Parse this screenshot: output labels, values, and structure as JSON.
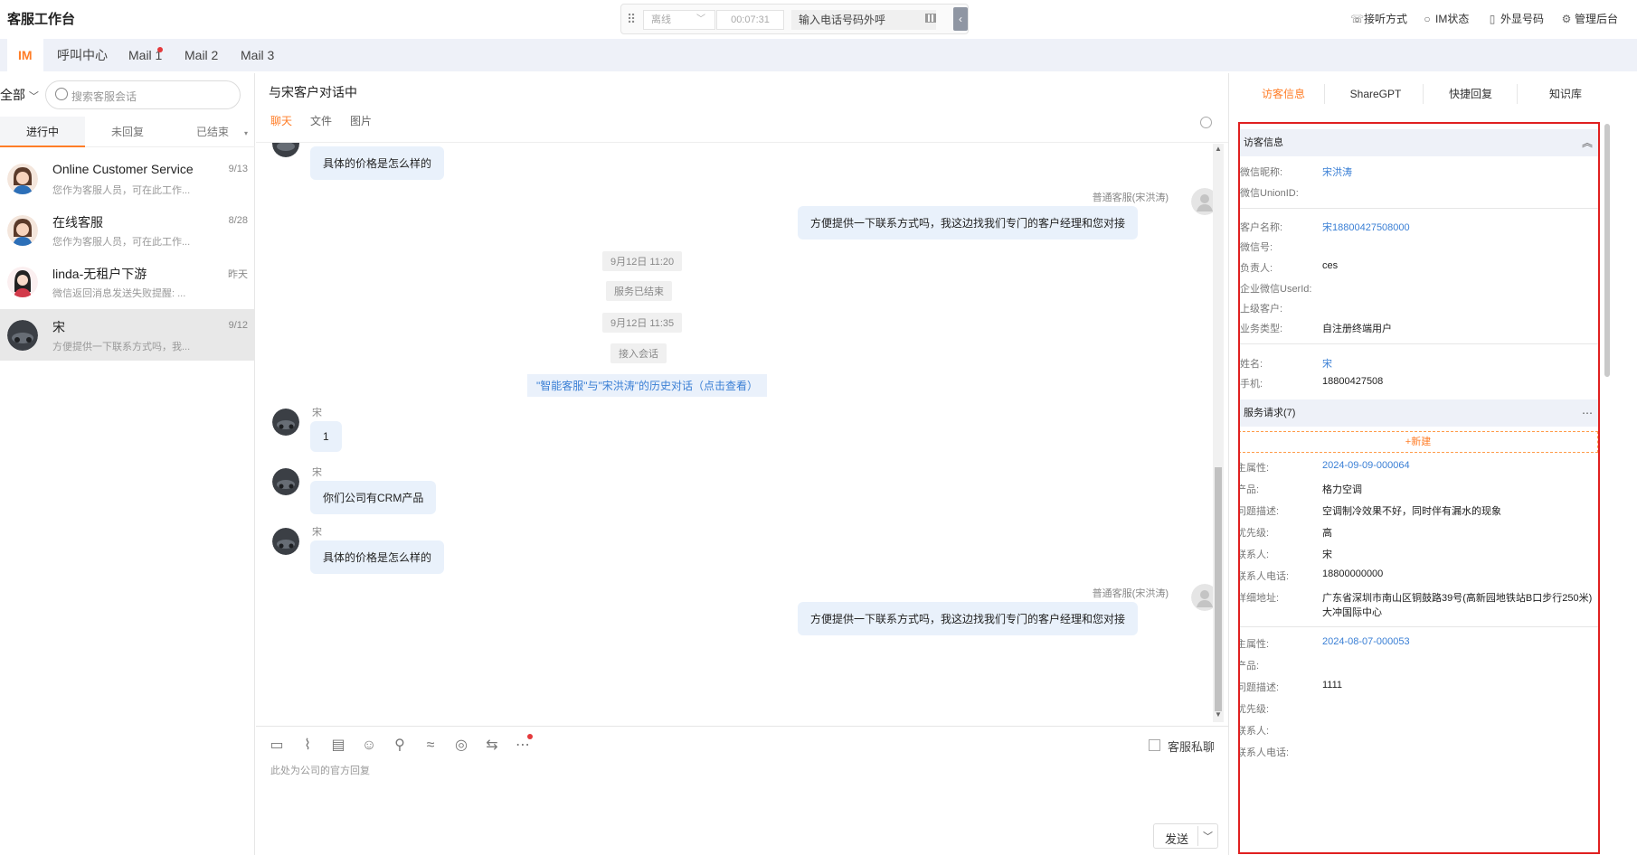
{
  "app": {
    "title": "客服工作台"
  },
  "phone": {
    "status": "离线",
    "timer": "00:07:31",
    "dial_placeholder": "输入电话号码外呼"
  },
  "top_menu": {
    "answer_mode": "接听方式",
    "im_status": "IM状态",
    "outbound_number": "外显号码",
    "admin": "管理后台"
  },
  "tabs": [
    {
      "label": "IM"
    },
    {
      "label": "呼叫中心"
    },
    {
      "label": "Mail 1"
    },
    {
      "label": "Mail 2"
    },
    {
      "label": "Mail 3"
    }
  ],
  "sidebar": {
    "filter": "全部",
    "search_placeholder": "搜索客服会话",
    "subtabs": [
      "进行中",
      "未回复",
      "已结束"
    ],
    "conversations": [
      {
        "name": "Online Customer Service",
        "date": "9/13",
        "preview": "您作为客服人员，可在此工作..."
      },
      {
        "name": "在线客服",
        "date": "8/28",
        "preview": "您作为客服人员，可在此工作..."
      },
      {
        "name": "linda-无租户下游",
        "date": "昨天",
        "preview": "微信返回消息发送失败提醒: ..."
      },
      {
        "name": "宋",
        "date": "9/12",
        "preview": "方便提供一下联系方式吗，我..."
      }
    ]
  },
  "chat": {
    "title": "与宋客户对话中",
    "tabs": [
      "聊天",
      "文件",
      "图片"
    ],
    "messages": {
      "top_bubble": "具体的价格是怎么样的",
      "agent_name_1": "普通客服(宋洪涛)",
      "agent_msg_1": "方便提供一下联系方式吗，我这边找我们专门的客户经理和您对接",
      "time_1": "9月12日 11:20",
      "sys_1": "服务已结束",
      "time_2": "9月12日 11:35",
      "sys_2": "接入会话",
      "history": "\"智能客服\"与\"宋洪涛\"的历史对话（点击查看）",
      "cust_name": "宋",
      "cust_msg_1": "1",
      "cust_msg_2": "你们公司有CRM产品",
      "cust_msg_3": "具体的价格是怎么样的",
      "agent_name_2": "普通客服(宋洪涛)",
      "agent_msg_2": "方便提供一下联系方式吗，我这边找我们专门的客户经理和您对接"
    },
    "private_label": "客服私聊",
    "composer_placeholder": "此处为公司的官方回复",
    "send": "发送"
  },
  "right": {
    "tabs": [
      "访客信息",
      "ShareGPT",
      "快捷回复",
      "知识库"
    ],
    "visitor_header": "访客信息",
    "wechat_nick_label": "微信昵称:",
    "wechat_nick": "宋洪涛",
    "unionid_label": "微信UnionID:",
    "customer_name_label": "客户名称:",
    "customer_name": "宋18800427508000",
    "wechat_id_label": "微信号:",
    "owner_label": "负责人:",
    "owner": "ces",
    "ent_userid_label": "企业微信UserId:",
    "parent_label": "上级客户:",
    "biz_type_label": "业务类型:",
    "biz_type": "自注册终端用户",
    "name_label": "姓名:",
    "name": "宋",
    "phone_label": "手机:",
    "phone": "18800427508",
    "service_header": "服务请求(7)",
    "new_label": "+新建",
    "req1": {
      "attr_label": "主属性:",
      "attr": "2024-09-09-000064",
      "product_label": "产品:",
      "product": "格力空调",
      "desc_label": "问题描述:",
      "desc": "空调制冷效果不好，同时伴有漏水的现象",
      "priority_label": "优先级:",
      "priority": "高",
      "contact_label": "联系人:",
      "contact": "宋",
      "contact_phone_label": "联系人电话:",
      "contact_phone": "18800000000",
      "address_label": "详细地址:",
      "address_1": "广东省深圳市南山区铜鼓路39号(高新园地铁站B口步行250米)",
      "address_2": "大冲国际中心"
    },
    "req2": {
      "attr_label": "主属性:",
      "attr": "2024-08-07-000053",
      "product_label": "产品:",
      "desc_label": "问题描述:",
      "desc": "1111",
      "priority_label": "优先级:",
      "contact_label": "联系人:",
      "contact_phone_label": "联系人电话:"
    }
  }
}
